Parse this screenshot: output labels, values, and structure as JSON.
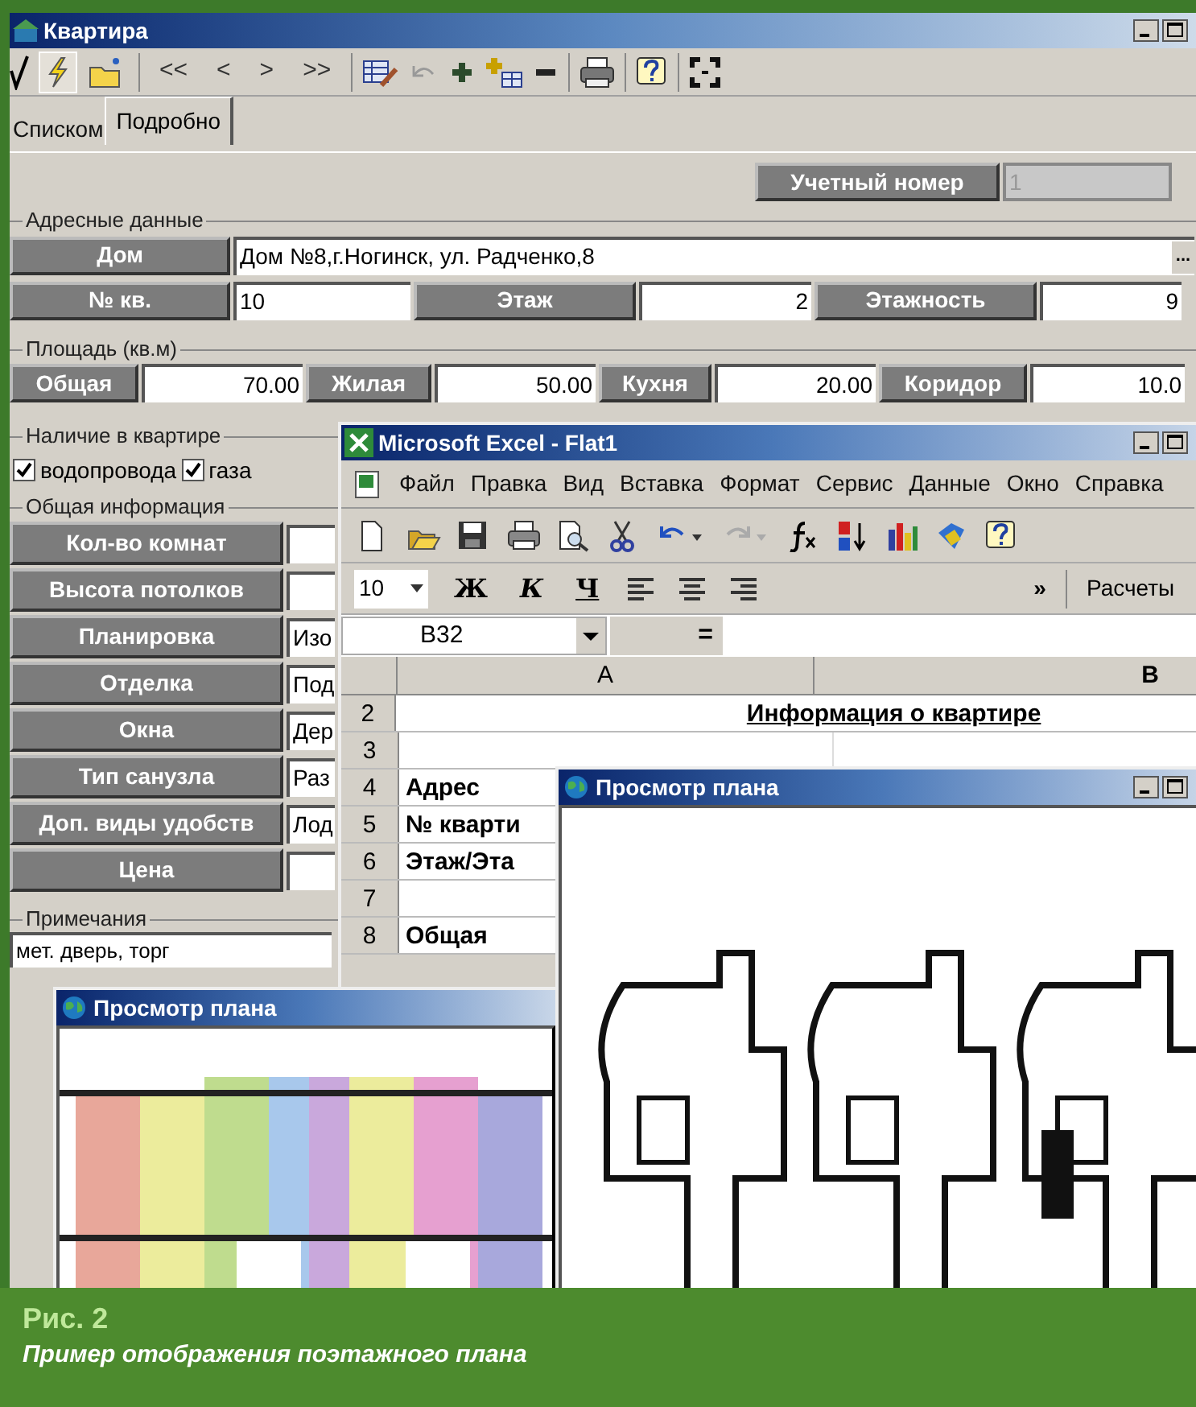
{
  "main_window": {
    "title": "Квартира",
    "toolbar_nav": [
      "<<",
      "<",
      ">",
      ">>"
    ],
    "tabs": [
      {
        "label": "Списком",
        "selected": false
      },
      {
        "label": "Подробно",
        "selected": true
      }
    ],
    "account_number": {
      "label": "Учетный номер",
      "value": "1",
      "disabled": true
    },
    "address_group": {
      "title": "Адресные данные",
      "house": {
        "label": "Дом",
        "value": "Дом №8,г.Ногинск, ул. Радченко,8",
        "button": "..."
      },
      "flat": {
        "label": "№ кв.",
        "value": "10"
      },
      "floor": {
        "label": "Этаж",
        "value": "2"
      },
      "floors": {
        "label": "Этажность",
        "value": "9"
      }
    },
    "area_group": {
      "title": "Площадь (кв.м)",
      "fields": [
        {
          "label": "Общая",
          "value": "70.00"
        },
        {
          "label": "Жилая",
          "value": "50.00"
        },
        {
          "label": "Кухня",
          "value": "20.00"
        },
        {
          "label": "Коридор",
          "value": "10.0"
        }
      ]
    },
    "amenities_group": {
      "title": "Наличие в квартире",
      "items": [
        {
          "label": "водопровода",
          "checked": true
        },
        {
          "label": "газа",
          "checked": true
        }
      ]
    },
    "general_group": {
      "title": "Общая информация",
      "fields": [
        {
          "label": "Кол-во комнат"
        },
        {
          "label": "Высота потолков"
        },
        {
          "label": "Планировка",
          "value": "Изо"
        },
        {
          "label": "Отделка",
          "value": "Под"
        },
        {
          "label": "Окна",
          "value": "Дер"
        },
        {
          "label": "Тип санузла",
          "value": "Раз"
        },
        {
          "label": "Доп. виды удобств",
          "value": "Лод"
        },
        {
          "label": "Цена"
        }
      ]
    },
    "notes": {
      "title": "Примечания",
      "value": "мет. дверь, торг"
    }
  },
  "excel_window": {
    "title": "Microsoft Excel - Flat1",
    "menu": [
      "Файл",
      "Правка",
      "Вид",
      "Вставка",
      "Формат",
      "Сервис",
      "Данные",
      "Окно",
      "Справка"
    ],
    "font_size": "10",
    "format_buttons": [
      "Ж",
      "К",
      "Ч"
    ],
    "more": "»",
    "style_box": "Расчеты",
    "name_box": "B32",
    "formula_sign": "=",
    "columns": [
      "A",
      "B"
    ],
    "rows": [
      {
        "number": "2",
        "cell_a": "Информация о квартире",
        "kind": "heading"
      },
      {
        "number": "3"
      },
      {
        "number": "4",
        "cell_a": "Адрес"
      },
      {
        "number": "5",
        "cell_a": "№ кварти"
      },
      {
        "number": "6",
        "cell_a": "Этаж/Эта"
      },
      {
        "number": "7"
      },
      {
        "number": "8",
        "cell_a": "Общая"
      }
    ]
  },
  "plan_windows": [
    {
      "title": "Просмотр плана"
    },
    {
      "title": "Просмотр плана"
    }
  ],
  "caption": {
    "label": "Рис. 2",
    "text": "Пример отображения поэтажного плана"
  }
}
